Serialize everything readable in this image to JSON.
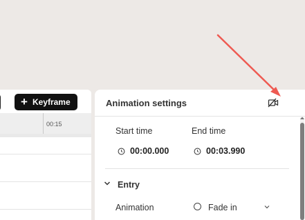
{
  "toolbar": {
    "keyframe_label": "Keyframe"
  },
  "timeline": {
    "ruler_tick": "00:15"
  },
  "settings": {
    "title": "Animation settings",
    "start_time_label": "Start time",
    "start_time_value": "00:00.000",
    "end_time_label": "End time",
    "end_time_value": "00:03.990",
    "entry_section": "Entry",
    "animation_label": "Animation",
    "animation_value": "Fade in"
  },
  "icons": {
    "camera_off": "camera-off-icon",
    "clock": "clock-icon",
    "chevron": "chevron-down-icon",
    "plus": "plus-icon"
  },
  "colors": {
    "annotation_arrow": "#ee5a52",
    "button_bg": "#111111"
  }
}
